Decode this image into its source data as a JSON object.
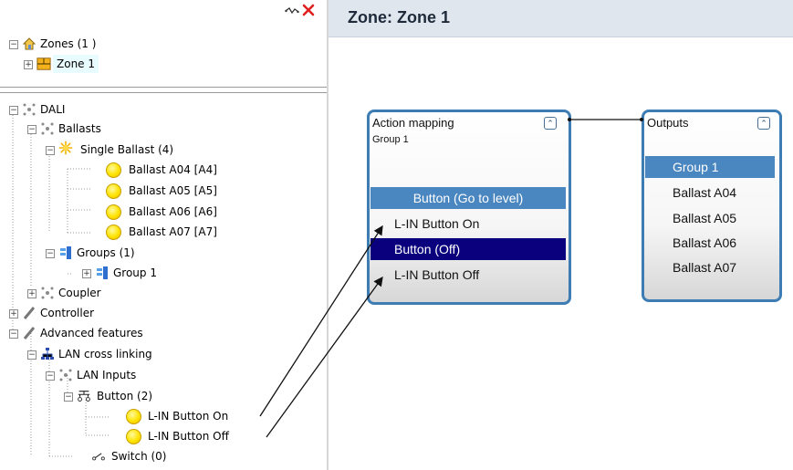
{
  "left_panel": {
    "toolbar_icons": [
      "connector-icon",
      "close-icon"
    ],
    "zones_tree": {
      "root": {
        "label": "Zones (1 )",
        "icon": "home-icon"
      },
      "children": [
        {
          "label": "Zone 1",
          "icon": "zone-icon"
        }
      ]
    },
    "dali_tree": {
      "dali": "DALI",
      "ballasts": "Ballasts",
      "single_ballast": "Single Ballast (4)",
      "ballast_items": [
        "Ballast A04 [A4]",
        "Ballast A05 [A5]",
        "Ballast A06 [A6]",
        "Ballast A07 [A7]"
      ],
      "groups": "Groups (1)",
      "group_1": "Group 1",
      "coupler": "Coupler",
      "controller": "Controller",
      "advanced_features": "Advanced features",
      "lan_cross_linking": "LAN cross linking",
      "lan_inputs": "LAN Inputs",
      "button": "Button (2)",
      "button_items": [
        "L-IN Button On",
        "L-IN Button Off"
      ],
      "switch": "Switch (0)"
    }
  },
  "right_panel": {
    "header_title": "Zone: Zone 1",
    "action_node": {
      "title": "Action mapping",
      "subtitle": "Group 1",
      "items": [
        "Button (Go to level)",
        "L-IN Button On",
        "Button (Off)",
        "L-IN Button Off"
      ],
      "selected_index": 0,
      "highlight_index": 2
    },
    "outputs_node": {
      "title": "Outputs",
      "items": [
        "Group 1",
        "Ballast A04",
        "Ballast A05",
        "Ballast A06",
        "Ballast A07"
      ],
      "selected_index": 0
    }
  },
  "colors": {
    "accent": "#4a86c0",
    "dark_selection": "#0a007e",
    "node_border": "#3d7db4",
    "close_red": "#e02020"
  }
}
